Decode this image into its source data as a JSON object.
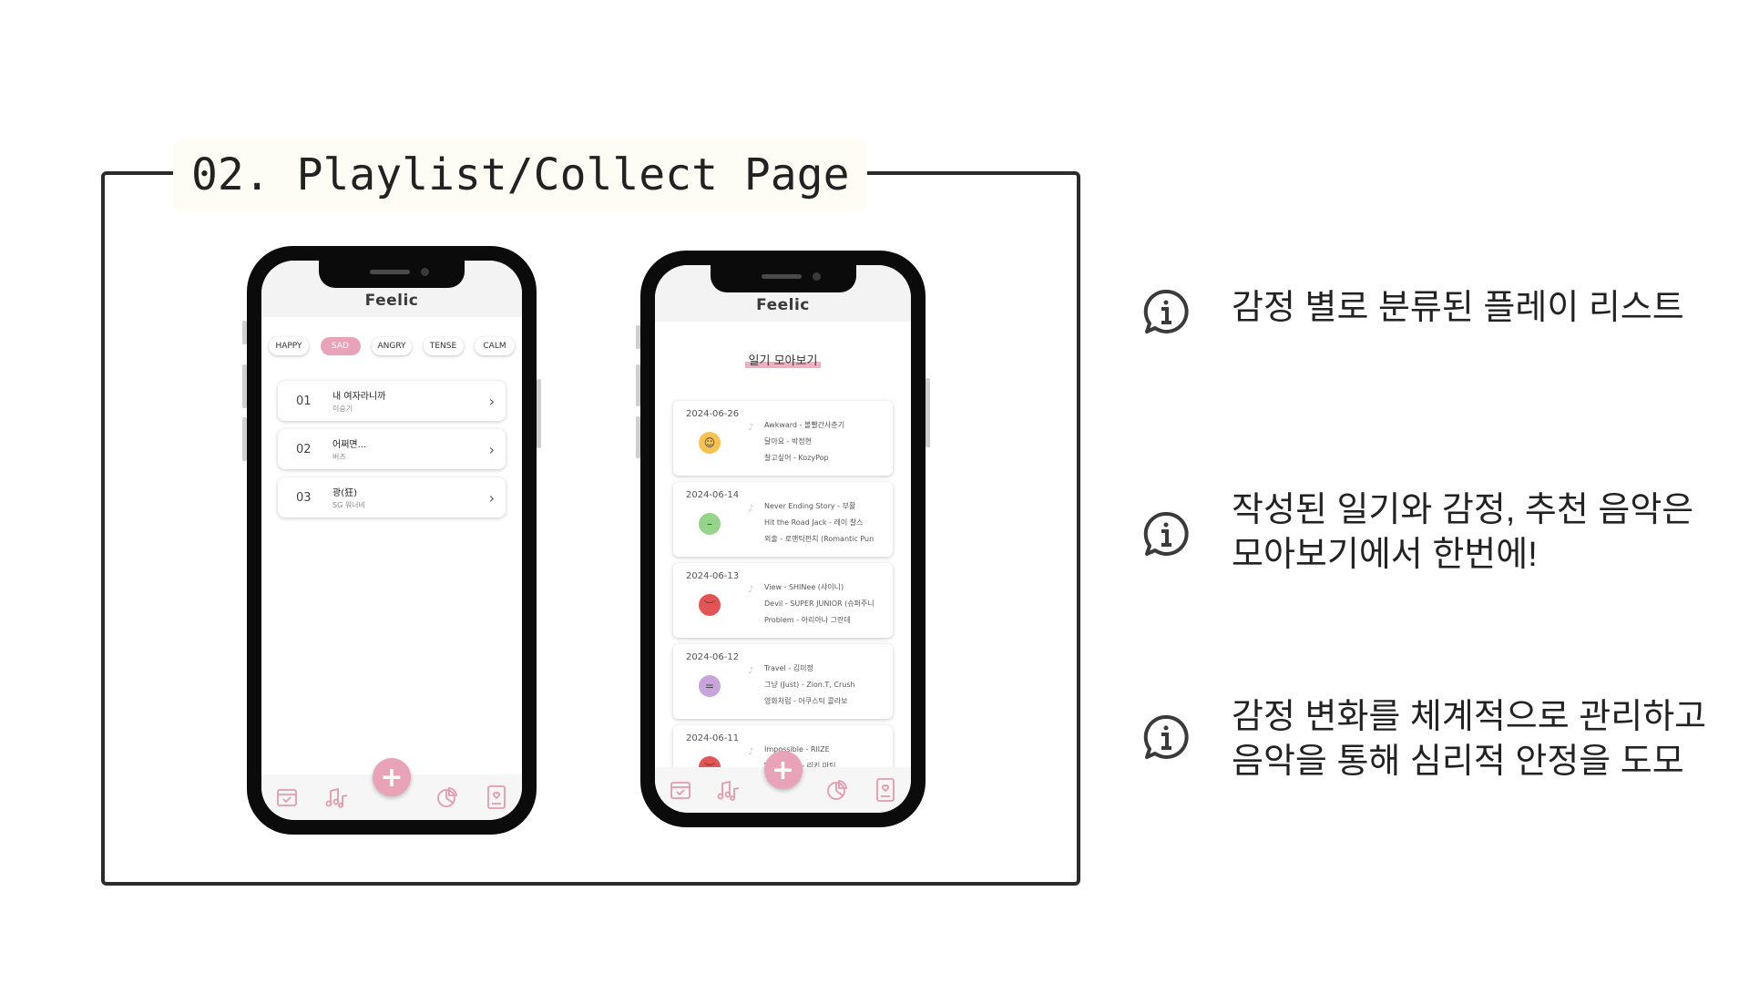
{
  "section_title": "02. Playlist/Collect Page",
  "playlist_phone": {
    "app_title": "Feelic",
    "emotion_tabs": [
      {
        "label": "HAPPY",
        "active": false
      },
      {
        "label": "SAD",
        "active": true
      },
      {
        "label": "ANGRY",
        "active": false
      },
      {
        "label": "TENSE",
        "active": false
      },
      {
        "label": "CALM",
        "active": false
      }
    ],
    "songs": [
      {
        "num": "01",
        "title": "내 여자라니까",
        "artist": "이승기"
      },
      {
        "num": "02",
        "title": "어쩌면...",
        "artist": "버즈"
      },
      {
        "num": "03",
        "title": "광(狂)",
        "artist": "SG 워너비"
      }
    ],
    "accent_color": "#e8a3b8"
  },
  "collect_phone": {
    "app_title": "Feelic",
    "page_title": "일기 모아보기",
    "entries": [
      {
        "date": "2024-06-26",
        "mood_color": "#f7c24f",
        "songs": [
          "Awkward - 볼빨간사춘기",
          "달아요 - 박정현",
          "찰고싶어 - KozyPop"
        ]
      },
      {
        "date": "2024-06-14",
        "mood_color": "#96d48c",
        "songs": [
          "Never Ending Story - 부활",
          "Hit the Road Jack - 레이 찰스",
          "외출 - 로맨틱펀치 (Romantic Pun"
        ]
      },
      {
        "date": "2024-06-13",
        "mood_color": "#e35454",
        "songs": [
          "View - SHINee (샤이니)",
          "Devil - SUPER JUNIOR (슈퍼주니",
          "Problem - 아리아나 그란데"
        ]
      },
      {
        "date": "2024-06-12",
        "mood_color": "#c9a4dc",
        "songs": [
          "Travel - 김미정",
          "그냥 (Just) - Zion.T, Crush",
          "영화처럼 - 어쿠스틱 콜라보"
        ]
      },
      {
        "date": "2024-06-11",
        "mood_color": "#e35454",
        "songs": [
          "Impossible - RIIZE",
          "Vida Loca - 리키 마틴",
          ""
        ]
      }
    ]
  },
  "info_points": [
    {
      "lines": [
        "감정 별로 분류된 플레이 리스트"
      ]
    },
    {
      "lines": [
        "작성된 일기와 감정, 추천 음악은",
        "모아보기에서 한번에!"
      ]
    },
    {
      "lines": [
        "감정 변화를 체계적으로 관리하고",
        "음악을 통해 심리적 안정을 도모"
      ]
    }
  ]
}
